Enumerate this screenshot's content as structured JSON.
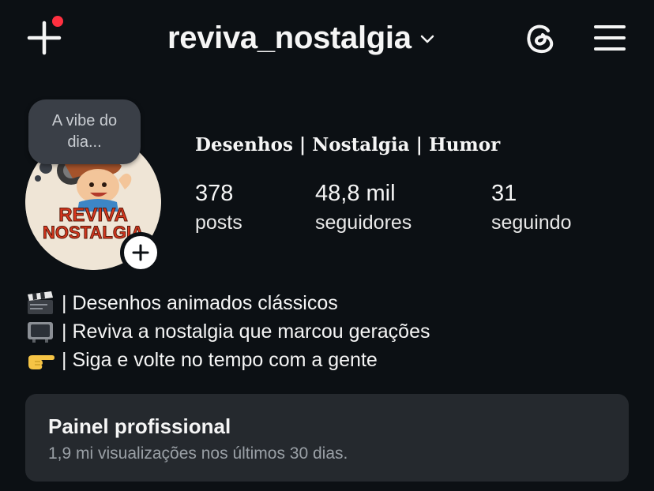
{
  "header": {
    "username": "reviva_nostalgia",
    "create_icon": "plus-icon",
    "threads_icon": "threads-icon",
    "menu_icon": "hamburger-menu-icon",
    "notification_dot_color": "#ff3040"
  },
  "note": {
    "text": "A vibe do dia..."
  },
  "profile": {
    "display_name": "Desenhos | Nostalgia | Humor",
    "avatar_logo_line1": "REVIVA",
    "avatar_logo_line2": "NOSTALGIA"
  },
  "stats": [
    {
      "value": "378",
      "label": "posts"
    },
    {
      "value": "48,8 mil",
      "label": "seguidores"
    },
    {
      "value": "31",
      "label": "seguindo"
    }
  ],
  "bio": [
    {
      "icon": "clapperboard-icon",
      "text": "| Desenhos animados clássicos"
    },
    {
      "icon": "television-icon",
      "text": "| Reviva a nostalgia que marcou gerações"
    },
    {
      "icon": "pointing-hand-icon",
      "text": "| Siga e volte no tempo com a gente"
    }
  ],
  "dashboard": {
    "title": "Painel profissional",
    "subtitle": "1,9 mi visualizações nos últimos 30 dias."
  }
}
